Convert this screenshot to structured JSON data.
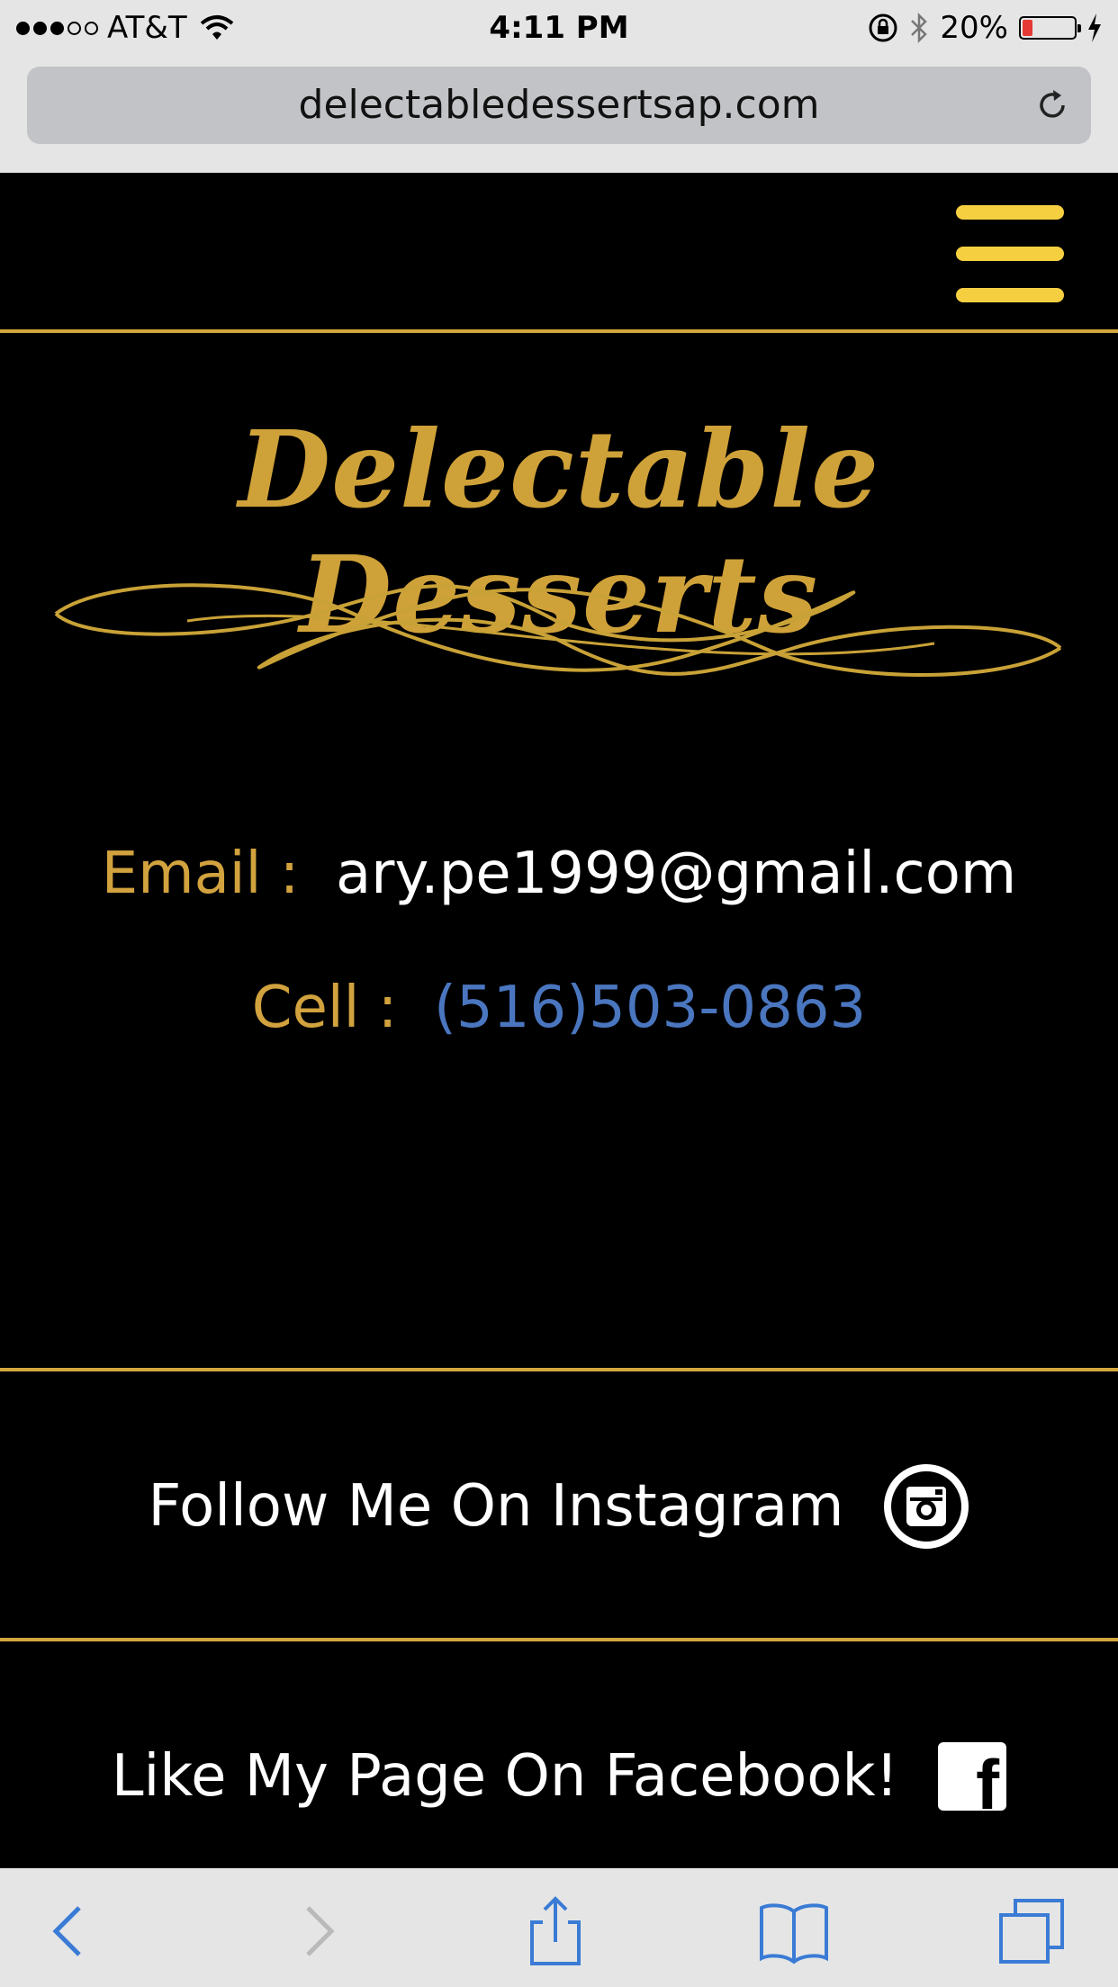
{
  "status_bar": {
    "carrier": "AT&T",
    "time": "4:11 PM",
    "battery_percent": "20%",
    "battery_level": 0.2,
    "signal_icon": "signal-dots-icon",
    "wifi_icon": "wifi-icon",
    "colors": {
      "battery_low": "#e53935"
    }
  },
  "browser": {
    "url": "delectabledessertsap.com"
  },
  "site": {
    "logo": "Delectable Desserts",
    "colors": {
      "gold": "#d1a23e",
      "menu": "#f6cf41",
      "link": "#4a76bf",
      "background": "#000000"
    }
  },
  "contact": {
    "email_label": "Email :",
    "email_value": "ary.pe1999@gmail.com",
    "cell_label": "Cell :",
    "cell_value": "(516)503-0863"
  },
  "social": {
    "instagram_text": "Follow Me On Instagram",
    "facebook_text": "Like My Page On Facebook!"
  },
  "toolbar": {
    "icons": [
      "back-icon",
      "forward-icon",
      "share-icon",
      "bookmarks-icon",
      "tabs-icon"
    ]
  }
}
